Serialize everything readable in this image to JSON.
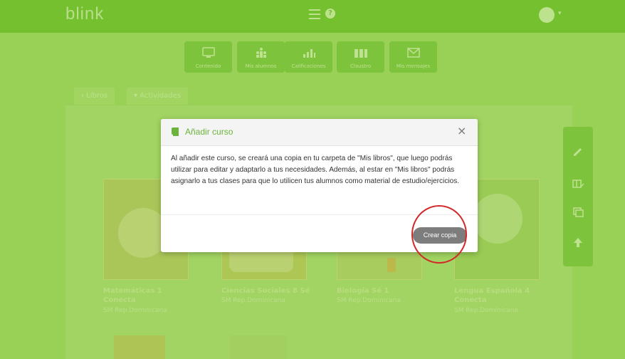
{
  "app": {
    "logo": "blink"
  },
  "header": {
    "menu_icon": "hamburger-icon",
    "help_icon": "question-icon",
    "help_glyph": "?",
    "avatar_caret": "▾"
  },
  "nav": [
    {
      "label": "Contenido",
      "icon": "monitor-icon"
    },
    {
      "label": "Mis alumnos",
      "icon": "students-icon"
    },
    {
      "label": "Calificaciones",
      "icon": "bar-chart-icon"
    },
    {
      "label": "Claustro",
      "icon": "faculty-icon"
    },
    {
      "label": "Mis mensajes",
      "icon": "envelope-icon"
    }
  ],
  "tabs": [
    {
      "label": "› Libros"
    },
    {
      "label": "▾ Actividades"
    }
  ],
  "books": [
    {
      "title": "Matemáticas 1 Conecta",
      "publisher": "SM Rep.Dominicana"
    },
    {
      "title": "Ciencias Sociales 8 Sé",
      "publisher": "SM Rep.Dominicana"
    },
    {
      "title": "Biología Sé 1",
      "publisher": "SM Rep.Dominicana"
    },
    {
      "title": "Lengua Española 4 Conecta",
      "publisher": "SM Rep.Dominicana"
    }
  ],
  "sidebar_icons": [
    "pencil-icon",
    "book-edit-icon",
    "copy-icon",
    "arrow-up-icon"
  ],
  "modal": {
    "title": "Añadir curso",
    "close": "×",
    "body": "Al añadir este curso, se creará una copia en tu carpeta de \"Mis libros\", que luego podrás utilizar para editar y adaptarlo a tus necesidades. Además, al estar en \"Mis libros\" podrás asignarlo a tus clases para que lo utilicen tus alumnos como material de estudio/ejercicios.",
    "create_button": "Crear copia"
  },
  "colors": {
    "accent": "#72c02c",
    "title": "#6bb33a",
    "button": "#7d7d7d",
    "highlight": "#d22a2a"
  }
}
